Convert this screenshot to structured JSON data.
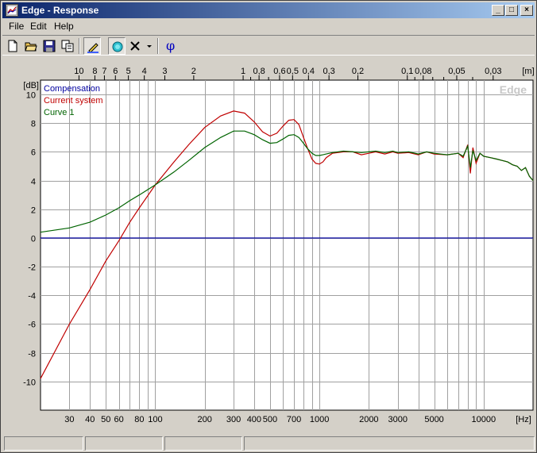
{
  "window": {
    "title": "Edge - Response",
    "minimize_glyph": "_",
    "maximize_glyph": "□",
    "close_glyph": "×"
  },
  "menu": {
    "items": [
      "File",
      "Edit",
      "Help"
    ]
  },
  "toolbar": {
    "buttons": [
      "new-file-icon",
      "open-folder-icon",
      "save-icon",
      "copy-icon",
      "edit-pen-icon",
      "speaker-icon",
      "delete-x-icon",
      "dropdown-arrow-icon",
      "phase-icon"
    ],
    "phase_label": "φ"
  },
  "chart_data": {
    "type": "line",
    "watermark": "Edge",
    "xlabel": "[Hz]",
    "ylabel": "[dB]",
    "top_axis_label": "[m]",
    "x_scale": "log",
    "xlim": [
      20,
      20000
    ],
    "ylim": [
      -12,
      11
    ],
    "y_ticks": [
      10,
      8,
      6,
      4,
      2,
      0,
      -2,
      -4,
      -6,
      -8,
      -10
    ],
    "x_tick_labels": [
      {
        "value": 30,
        "label": "30"
      },
      {
        "value": 40,
        "label": "40"
      },
      {
        "value": 50,
        "label": "50"
      },
      {
        "value": 60,
        "label": "60"
      },
      {
        "value": 80,
        "label": "80"
      },
      {
        "value": 100,
        "label": "100"
      },
      {
        "value": 200,
        "label": "200"
      },
      {
        "value": 300,
        "label": "300"
      },
      {
        "value": 400,
        "label": "400"
      },
      {
        "value": 500,
        "label": "500"
      },
      {
        "value": 700,
        "label": "700"
      },
      {
        "value": 1000,
        "label": "1000"
      },
      {
        "value": 2000,
        "label": "2000"
      },
      {
        "value": 3000,
        "label": "3000"
      },
      {
        "value": 5000,
        "label": "5000"
      },
      {
        "value": 10000,
        "label": "10000"
      }
    ],
    "x_grid": [
      30,
      40,
      50,
      60,
      70,
      80,
      90,
      100,
      200,
      300,
      400,
      500,
      600,
      700,
      800,
      900,
      1000,
      2000,
      3000,
      4000,
      5000,
      6000,
      7000,
      8000,
      9000,
      10000
    ],
    "top_ticks": [
      {
        "label": "10",
        "m": 10
      },
      {
        "label": "8",
        "m": 8
      },
      {
        "label": "7",
        "m": 7
      },
      {
        "label": "6",
        "m": 6
      },
      {
        "label": "5",
        "m": 5
      },
      {
        "label": "4",
        "m": 4
      },
      {
        "label": "3",
        "m": 3
      },
      {
        "label": "2",
        "m": 2
      },
      {
        "label": "1",
        "m": 1
      },
      {
        "label": "0,8",
        "m": 0.8
      },
      {
        "label": "0,6",
        "m": 0.6
      },
      {
        "label": "0,5",
        "m": 0.5
      },
      {
        "label": "0,4",
        "m": 0.4
      },
      {
        "label": "0,3",
        "m": 0.3
      },
      {
        "label": "0,2",
        "m": 0.2
      },
      {
        "label": "0,1",
        "m": 0.1
      },
      {
        "label": "0,08",
        "m": 0.08
      },
      {
        "label": "0,05",
        "m": 0.05
      },
      {
        "label": "0,03",
        "m": 0.03
      }
    ],
    "top_minor_ticks": [
      0.9,
      0.7,
      0.09,
      0.07,
      0.06,
      0.04
    ],
    "grid": true,
    "legend_position": "top-left",
    "series": [
      {
        "name": "Compensation",
        "color": "#0000a0",
        "x": [
          20,
          20000
        ],
        "y": [
          0,
          0
        ]
      },
      {
        "name": "Current system",
        "color": "#c00000",
        "x": [
          20,
          30,
          40,
          50,
          60,
          70,
          80,
          100,
          130,
          160,
          200,
          250,
          300,
          350,
          400,
          450,
          500,
          550,
          600,
          650,
          700,
          750,
          800,
          850,
          900,
          950,
          1000,
          1050,
          1100,
          1200,
          1400,
          1600,
          1800,
          2000,
          2200,
          2500,
          2800,
          3000,
          3500,
          4000,
          4500,
          5000,
          6000,
          7000,
          7500,
          8000,
          8300,
          8600,
          9000,
          9500,
          10000,
          11000,
          12000,
          13000,
          14000,
          15000,
          16000,
          17000,
          18000,
          19000,
          20000
        ],
        "y": [
          -9.8,
          -6.0,
          -3.6,
          -1.6,
          -0.2,
          1.1,
          2.1,
          3.7,
          5.3,
          6.5,
          7.7,
          8.5,
          8.85,
          8.7,
          8.1,
          7.4,
          7.1,
          7.3,
          7.8,
          8.2,
          8.25,
          7.9,
          7.0,
          6.2,
          5.5,
          5.2,
          5.15,
          5.3,
          5.6,
          5.9,
          6.0,
          6.0,
          5.8,
          5.9,
          6.0,
          5.85,
          6.0,
          5.9,
          5.95,
          5.8,
          6.0,
          5.85,
          5.8,
          5.9,
          5.6,
          6.5,
          4.5,
          6.3,
          5.2,
          5.9,
          5.7,
          5.6,
          5.5,
          5.4,
          5.3,
          5.1,
          5.0,
          4.7,
          4.9,
          4.3,
          4.0
        ]
      },
      {
        "name": "Curve 1",
        "color": "#006400",
        "x": [
          20,
          30,
          40,
          50,
          60,
          70,
          80,
          100,
          130,
          160,
          200,
          250,
          300,
          350,
          400,
          450,
          500,
          550,
          600,
          650,
          700,
          750,
          800,
          850,
          900,
          950,
          1000,
          1050,
          1100,
          1200,
          1400,
          1600,
          1800,
          2000,
          2200,
          2500,
          2800,
          3000,
          3500,
          4000,
          4500,
          5000,
          6000,
          7000,
          7500,
          8000,
          8300,
          8600,
          9000,
          9500,
          10000,
          11000,
          12000,
          13000,
          14000,
          15000,
          16000,
          17000,
          18000,
          19000,
          20000
        ],
        "y": [
          0.4,
          0.7,
          1.1,
          1.6,
          2.1,
          2.6,
          3.0,
          3.7,
          4.6,
          5.4,
          6.3,
          7.0,
          7.45,
          7.45,
          7.2,
          6.85,
          6.6,
          6.65,
          6.9,
          7.15,
          7.2,
          7.0,
          6.6,
          6.2,
          5.9,
          5.75,
          5.75,
          5.8,
          5.85,
          5.95,
          6.05,
          6.0,
          5.95,
          6.0,
          6.05,
          5.95,
          6.05,
          5.95,
          6.0,
          5.85,
          6.0,
          5.9,
          5.8,
          5.9,
          5.7,
          6.4,
          4.9,
          6.1,
          5.4,
          5.9,
          5.7,
          5.6,
          5.5,
          5.4,
          5.3,
          5.1,
          5.0,
          4.7,
          4.9,
          4.3,
          4.0
        ]
      }
    ]
  }
}
